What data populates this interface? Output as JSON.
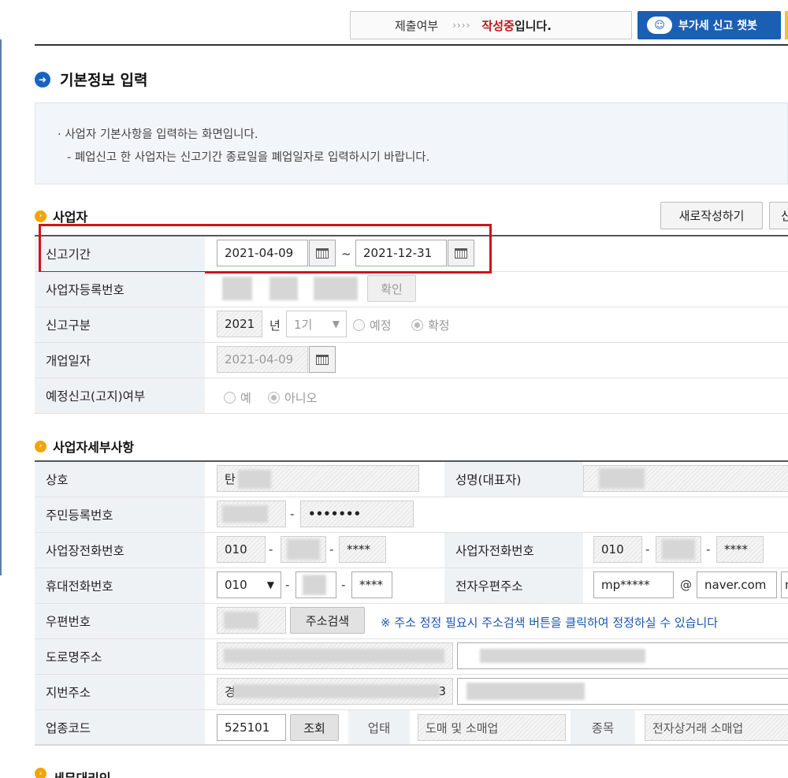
{
  "header": {
    "submit_status_label": "제출여부",
    "status_arrows": "››››",
    "status_highlight": "작성중",
    "status_suffix": "입니다.",
    "chatbot_label": "부가세 신고 챗봇"
  },
  "page": {
    "title": "기본정보 입력",
    "info_line1": "· 사업자 기본사항을 입력하는 화면입니다.",
    "info_line2": "- 폐업신고 한 사업자는 신고기간 종료일을 폐업일자로 입력하시기 바랍니다."
  },
  "business": {
    "section_title": "사업자",
    "new_button": "새로작성하기",
    "cut_button": "신",
    "period_label": "신고기간",
    "period_start": "2021-04-09",
    "period_sep": "~",
    "period_end": "2021-12-31",
    "regno_label": "사업자등록번호",
    "confirm_button": "확인",
    "type_label": "신고구분",
    "year": "2021",
    "year_unit": "년",
    "term": "1기",
    "radio_estimate": "예정",
    "radio_final": "확정",
    "opendate_label": "개업일자",
    "opendate": "2021-04-09",
    "notice_label": "예정신고(고지)여부",
    "radio_yes": "예",
    "radio_no": "아니오"
  },
  "detail": {
    "section_title": "사업자세부사항",
    "company_label": "상호",
    "company_value": "탄",
    "rep_label": "성명(대표자)",
    "resid_label": "주민등록번호",
    "resid_dash": "-",
    "resid_back": "•••••••",
    "bizphone_label": "사업장전화번호",
    "bizphone_1": "010",
    "dash": "-",
    "bizphone_3": "****",
    "ownerphone_label": "사업자전화번호",
    "ownerphone_1": "010",
    "ownerphone_3": "****",
    "mobile_label": "휴대전화번호",
    "mobile_1": "010",
    "mobile_3": "****",
    "email_label": "전자우편주소",
    "email_id": "mp*****",
    "email_at": "@",
    "email_domain": "naver.com",
    "email_select_cut": "n",
    "zip_label": "우편번호",
    "addr_search_button": "주소검색",
    "zip_note": "※ 주소 정정 필요시 주소검색 버튼을 클릭하여 정정하실 수 있습니다",
    "road_label": "도로명주소",
    "lot_label": "지번주소",
    "lot_prefix": "경",
    "lot_suffix": "3",
    "industry_label": "업종코드",
    "industry_code": "525101",
    "lookup_button": "조회",
    "biztype_label": "업태",
    "biztype_value": "도매 및 소매업",
    "item_label": "종목",
    "item_value": "전자상거래 소매업"
  },
  "agent": {
    "section_title": "세무대리인"
  }
}
